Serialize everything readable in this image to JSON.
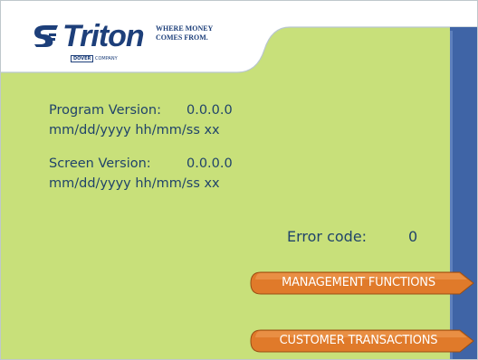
{
  "brand": {
    "name": "Triton",
    "tagline": "WHERE MONEY\nCOMES FROM.",
    "company_mark": "DOVER",
    "company_suffix": "COMPANY"
  },
  "info": {
    "program_label": "Program Version:",
    "program_value": "0.0.0.0",
    "program_datetime": "mm/dd/yyyy hh/mm/ss xx",
    "screen_label": "Screen Version:",
    "screen_value": "0.0.0.0",
    "screen_datetime": "mm/dd/yyyy hh/mm/ss xx"
  },
  "error": {
    "label": "Error code:",
    "value": "0"
  },
  "buttons": {
    "management": "MANAGEMENT FUNCTIONS",
    "customer": "CUSTOMER TRANSACTIONS"
  },
  "colors": {
    "background": "#c8e07a",
    "sidebar": "#3f64a6",
    "text": "#20436a",
    "button": "#e07a2a"
  }
}
